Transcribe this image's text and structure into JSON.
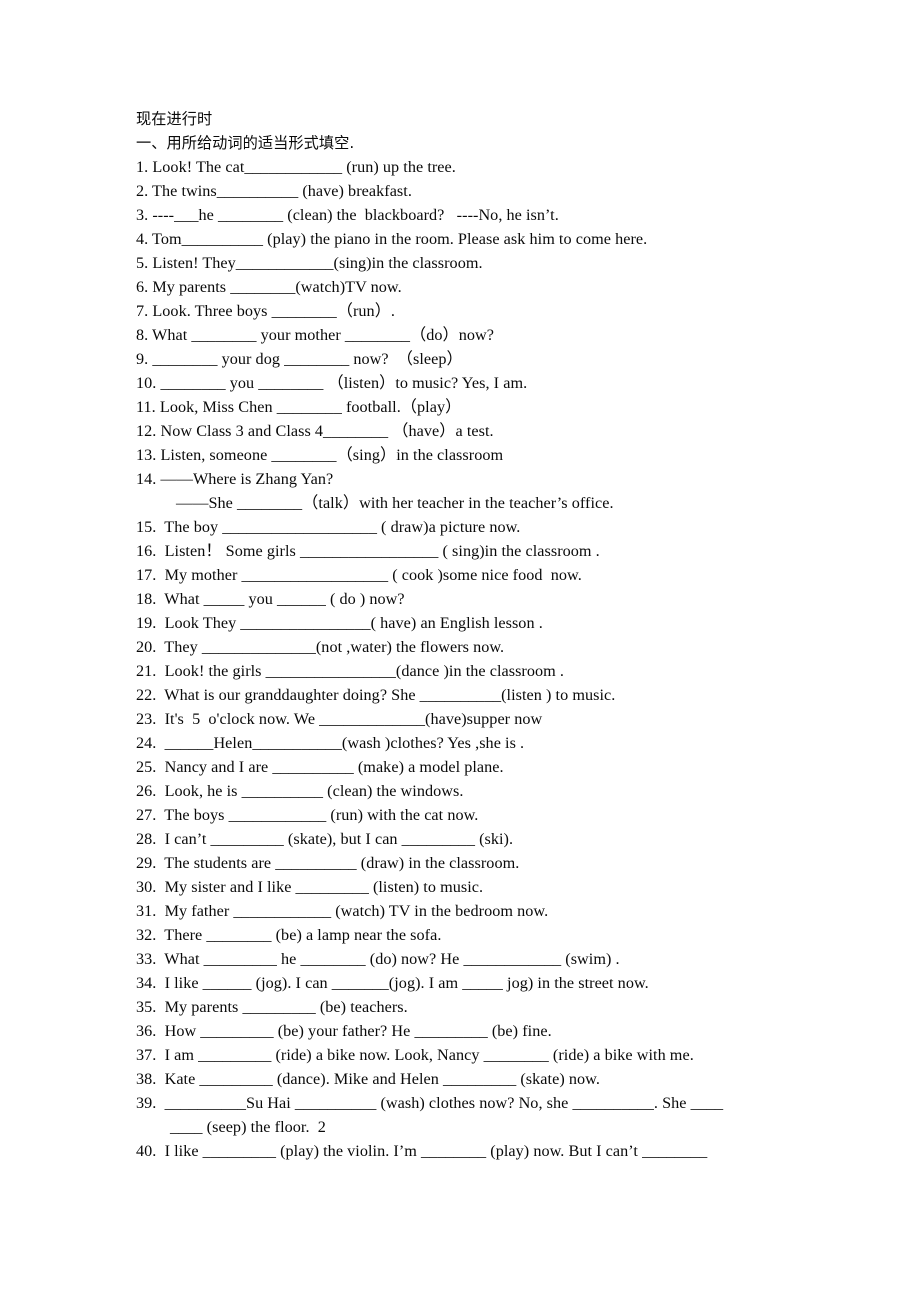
{
  "document": {
    "title": "现在进行时",
    "instruction": "一、用所给动词的适当形式填空.",
    "background_color": "#ffffff",
    "text_color": "#000000",
    "items": [
      {
        "n": "1.",
        "text": "1. Look! The cat____________ (run) up the tree."
      },
      {
        "n": "2.",
        "text": "2. The twins__________ (have) breakfast."
      },
      {
        "n": "3.",
        "text": "3. ----___he ________ (clean) the  blackboard?   ----No, he isn’t."
      },
      {
        "n": "4.",
        "text": "4. Tom__________ (play) the piano in the room. Please ask him to come here."
      },
      {
        "n": "5.",
        "text": "5. Listen! They____________(sing)in the classroom."
      },
      {
        "n": "6.",
        "text": "6. My parents ________(watch)TV now."
      },
      {
        "n": "7.",
        "text": "7. Look. Three boys ________（run）."
      },
      {
        "n": "8.",
        "text": "8. What ________ your mother ________（do）now?"
      },
      {
        "n": "9.",
        "text": "9. ________ your dog ________ now?  （sleep）"
      },
      {
        "n": "10.",
        "text": "10. ________ you ________ （listen）to music? Yes, I am."
      },
      {
        "n": "11.",
        "text": "11. Look, Miss Chen ________ football.（play）"
      },
      {
        "n": "12.",
        "text": "12. Now Class 3 and Class 4________ （have）a test."
      },
      {
        "n": "13.",
        "text": "13. Listen, someone ________（sing）in the classroom"
      },
      {
        "n": "14.",
        "text": "14. ——Where is Zhang Yan?"
      },
      {
        "n": "14b",
        "text": "——She ________（talk）with her teacher in the teacher’s office."
      },
      {
        "n": "15.",
        "text": "15.  The boy ___________________ ( draw)a picture now."
      },
      {
        "n": "16.",
        "text": "16.  Listen！ Some girls _________________ ( sing)in the classroom ."
      },
      {
        "n": "17.",
        "text": "17.  My mother __________________ ( cook )some nice food  now."
      },
      {
        "n": "18.",
        "text": "18.  What _____ you ______ ( do ) now?"
      },
      {
        "n": "19.",
        "text": "19.  Look They ________________( have) an English lesson ."
      },
      {
        "n": "20.",
        "text": "20.  They ______________(not ,water) the flowers now."
      },
      {
        "n": "21.",
        "text": "21.  Look! the girls ________________(dance )in the classroom ."
      },
      {
        "n": "22.",
        "text": "22.  What is our granddaughter doing? She __________(listen ) to music."
      },
      {
        "n": "23.",
        "text": "23.  It's  5  o'clock now. We _____________(have)supper now"
      },
      {
        "n": "24.",
        "text": "24.  ______Helen___________(wash )clothes? Yes ,she is ."
      },
      {
        "n": "25.",
        "text": "25.  Nancy and I are __________ (make) a model plane."
      },
      {
        "n": "26.",
        "text": "26.  Look, he is __________ (clean) the windows."
      },
      {
        "n": "27.",
        "text": "27.  The boys ____________ (run) with the cat now."
      },
      {
        "n": "28.",
        "text": "28.  I can’t _________ (skate), but I can _________ (ski)."
      },
      {
        "n": "29.",
        "text": "29.  The students are __________ (draw) in the classroom."
      },
      {
        "n": "30.",
        "text": "30.  My sister and I like _________ (listen) to music."
      },
      {
        "n": "31.",
        "text": "31.  My father ____________ (watch) TV in the bedroom now."
      },
      {
        "n": "32.",
        "text": "32.  There ________ (be) a lamp near the sofa."
      },
      {
        "n": "33.",
        "text": "33.  What _________ he ________ (do) now? He ____________ (swim) ."
      },
      {
        "n": "34.",
        "text": "34.  I like ______ (jog). I can _______(jog). I am _____ jog) in the street now."
      },
      {
        "n": "35.",
        "text": "35.  My parents _________ (be) teachers."
      },
      {
        "n": "36.",
        "text": "36.  How _________ (be) your father? He _________ (be) fine."
      },
      {
        "n": "37.",
        "text": "37.  I am _________ (ride) a bike now. Look, Nancy ________ (ride) a bike with me."
      },
      {
        "n": "38.",
        "text": "38.  Kate _________ (dance). Mike and Helen _________ (skate) now."
      },
      {
        "n": "39.",
        "text": "39.  __________Su Hai __________ (wash) clothes now? No, she __________. She ____"
      },
      {
        "n": "39b",
        "text": "____ (seep) the floor.  2"
      },
      {
        "n": "40.",
        "text": "40.  I like _________ (play) the violin. I’m ________ (play) now. But I can’t ________"
      }
    ]
  }
}
